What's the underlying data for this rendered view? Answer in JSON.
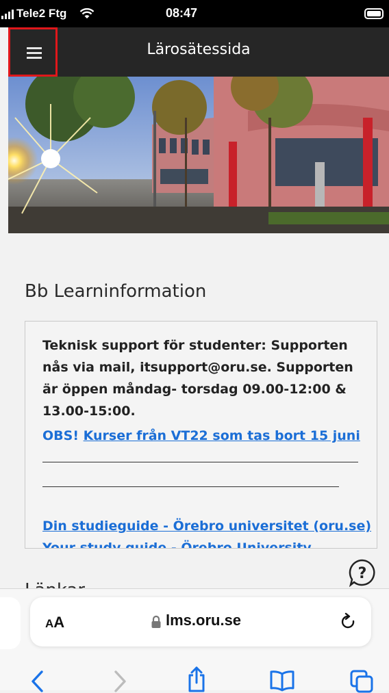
{
  "status_bar": {
    "carrier": "Tele2 Ftg",
    "time": "08:47"
  },
  "header": {
    "title": "Lärosätessida"
  },
  "section": {
    "title": "Bb Learninformation"
  },
  "info": {
    "support_text": "Teknisk support för studenter: Supporten nås via mail, itsupport@oru.se. Supporten är öppen måndag- torsdag 09.00-12:00 & 13.00-15:00.",
    "obs_label": "OBS!",
    "obs_link": "Kurser från VT22 som tas bort 15 juni",
    "study_link": "Din studieguide - Örebro universitet (oru.se)",
    "study_link_en": "Your study guide - Örebro University"
  },
  "links_heading": "Länkar",
  "browser": {
    "aa_small": "A",
    "aa_big": "A",
    "url": "lms.oru.se"
  },
  "colors": {
    "header": "#262626",
    "link": "#1b6ed6",
    "highlight": "#e0171b",
    "ios_blue": "#1a73e8"
  }
}
